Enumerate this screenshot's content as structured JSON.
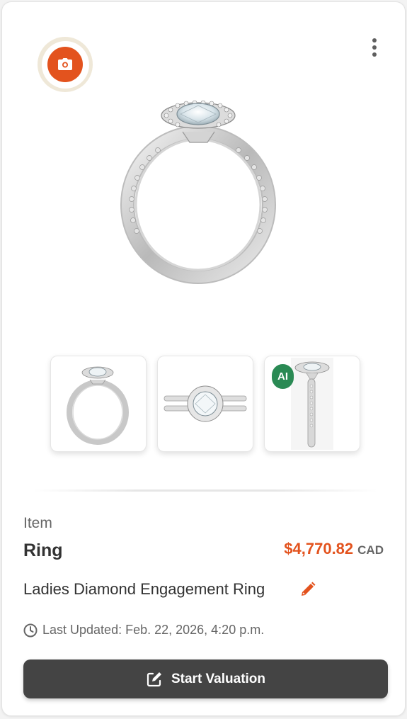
{
  "header": {
    "camera_icon": "camera-icon",
    "menu_icon": "kebab-menu-icon",
    "accent_color": "#e3531e"
  },
  "gallery": {
    "main_image": "ring-side-view",
    "thumbnails": [
      {
        "image": "ring-side-view",
        "badge": ""
      },
      {
        "image": "ring-top-view",
        "badge": ""
      },
      {
        "image": "ring-profile-view",
        "badge": "AI"
      }
    ]
  },
  "item": {
    "label": "Item",
    "name": "Ring",
    "price": "$4,770.82",
    "currency": "CAD",
    "description": "Ladies Diamond Engagement Ring",
    "last_updated": "Last Updated: Feb. 22, 2026, 4:20 p.m."
  },
  "actions": {
    "start_valuation_label": "Start Valuation",
    "edit_icon": "pencil-icon",
    "start_icon": "edit-square-icon"
  }
}
